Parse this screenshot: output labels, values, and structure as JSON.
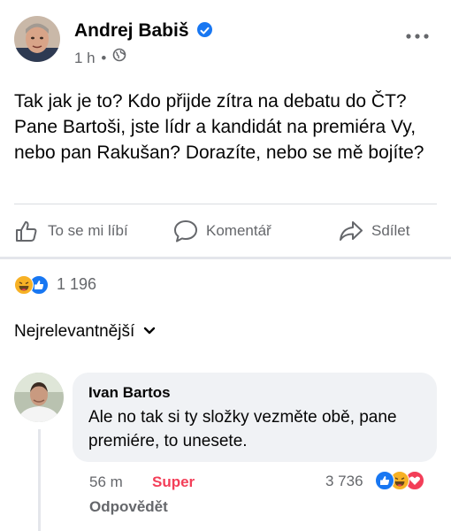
{
  "post": {
    "author": "Andrej Babiš",
    "time": "1 h",
    "separator": "•",
    "text": "Tak jak je to? Kdo přijde zítra na debatu do ČT? Pane Bartoši, jste lídr a kandidát na premiéra Vy, nebo pan Rakušan? Dorazíte, nebo se mě bojíte?"
  },
  "actions": {
    "like": "To se mi líbí",
    "comment": "Komentář",
    "share": "Sdílet"
  },
  "reactions": {
    "count": "1 196",
    "types": [
      "haha-icon",
      "like-icon"
    ]
  },
  "sort": {
    "label": "Nejrelevantnější"
  },
  "comment": {
    "author": "Ivan Bartos",
    "text": "Ale no tak si ty složky vezměte obě, pane premiére, to unesete.",
    "time": "56 m",
    "reaction_label": "Super",
    "reply_label": "Odpovědět",
    "reaction_count": "3 736",
    "reaction_types": [
      "like-icon",
      "haha-icon",
      "love-icon"
    ]
  },
  "colors": {
    "brand": "#1877f2",
    "super": "#f33e58",
    "haha": "#f7b125",
    "muted": "#65676b"
  }
}
